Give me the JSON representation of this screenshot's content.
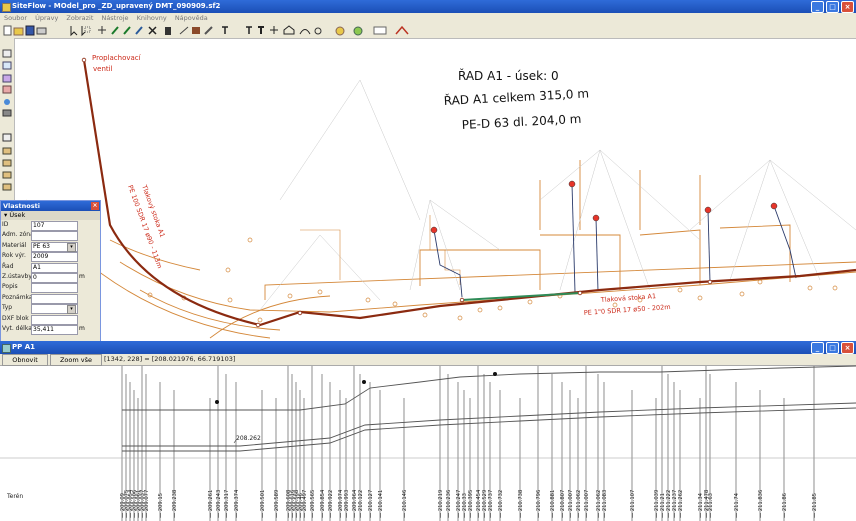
{
  "app": {
    "title": "SiteFlow - MOdel_pro _ZD_upravený DMT_090909.sf2",
    "menu": [
      "Soubor",
      "Úpravy",
      "Zobrazit",
      "Nástroje",
      "Knihovny",
      "Nápověda"
    ]
  },
  "map": {
    "valve_label_1": "Proplachovací",
    "valve_label_2": "ventil",
    "info_line1": "ŘAD A1 - úsek: 0",
    "info_line2": "ŘAD A1 celkem 315,0 m",
    "info_line3": "PE-D 63 dl. 204,0 m",
    "pipe_label_left1": "Tlakový stoka A1",
    "pipe_label_left2": "PE 100 SDR 17 ø90 - 113m",
    "pipe_label_right1": "Tlaková stoka A1",
    "pipe_label_right2": "PE 1\"0 SDR 17 ø50 - 202m",
    "colors": {
      "pipe": "#8b2a10",
      "survey": "#e08a3c",
      "highlight": "#2e8b57"
    }
  },
  "properties": {
    "title": "Vlastnosti",
    "section": "Úsek",
    "rows": [
      {
        "label": "ID",
        "value": "107",
        "unit": ""
      },
      {
        "label": "Adm. zóna",
        "value": "",
        "unit": ""
      },
      {
        "label": "Materiál",
        "value": "PE 63",
        "unit": "",
        "dropdown": true
      },
      {
        "label": "Rok výr.",
        "value": "2009",
        "unit": ""
      },
      {
        "label": "Řad",
        "value": "A1",
        "unit": ""
      },
      {
        "label": "Z.ústavby",
        "value": "0",
        "unit": "m"
      },
      {
        "label": "Popis",
        "value": "",
        "unit": ""
      },
      {
        "label": "Poznámka",
        "value": "",
        "unit": ""
      },
      {
        "label": "Typ",
        "value": "",
        "unit": "",
        "dropdown": true
      },
      {
        "label": "DXF blok",
        "value": "",
        "unit": ""
      },
      {
        "label": "Vyt. délka",
        "value": "35,411",
        "unit": "m"
      }
    ]
  },
  "profile": {
    "title": "PP A1",
    "refresh": "Obnovit",
    "zoom_all": "Zoom vše",
    "coords": "[1342, 228] = [208.021976, 66.719103]",
    "pipe_value": "208.262",
    "row_label": "Terén",
    "terrain_values": [
      "209.09",
      "209.075",
      "209.054",
      "209.106",
      "209.061",
      "209.037",
      "209.077",
      "209.15",
      "209.238",
      "209.261",
      "209.243",
      "209.317",
      "209.374",
      "209.501",
      "209.589",
      "209.608",
      "209.616",
      "209.568",
      "209.46",
      "209.497",
      "209.565",
      "209.854",
      "209.922",
      "209.974",
      "209.993",
      "209.964",
      "210.122",
      "210.127",
      "210.141",
      "210.146",
      "210.219",
      "210.236",
      "210.247",
      "210.33",
      "210.395",
      "210.454",
      "210.529",
      "210.737",
      "210.732",
      "210.738",
      "210.796",
      "210.881",
      "210.807",
      "211.007",
      "211.062",
      "211.007",
      "211.062",
      "211.083",
      "211.107",
      "211.039",
      "211.21",
      "211.222",
      "211.237",
      "211.262",
      "211.34",
      "211.478",
      "211.63",
      "211.74",
      "211.836",
      "211.86",
      "211.85"
    ]
  }
}
